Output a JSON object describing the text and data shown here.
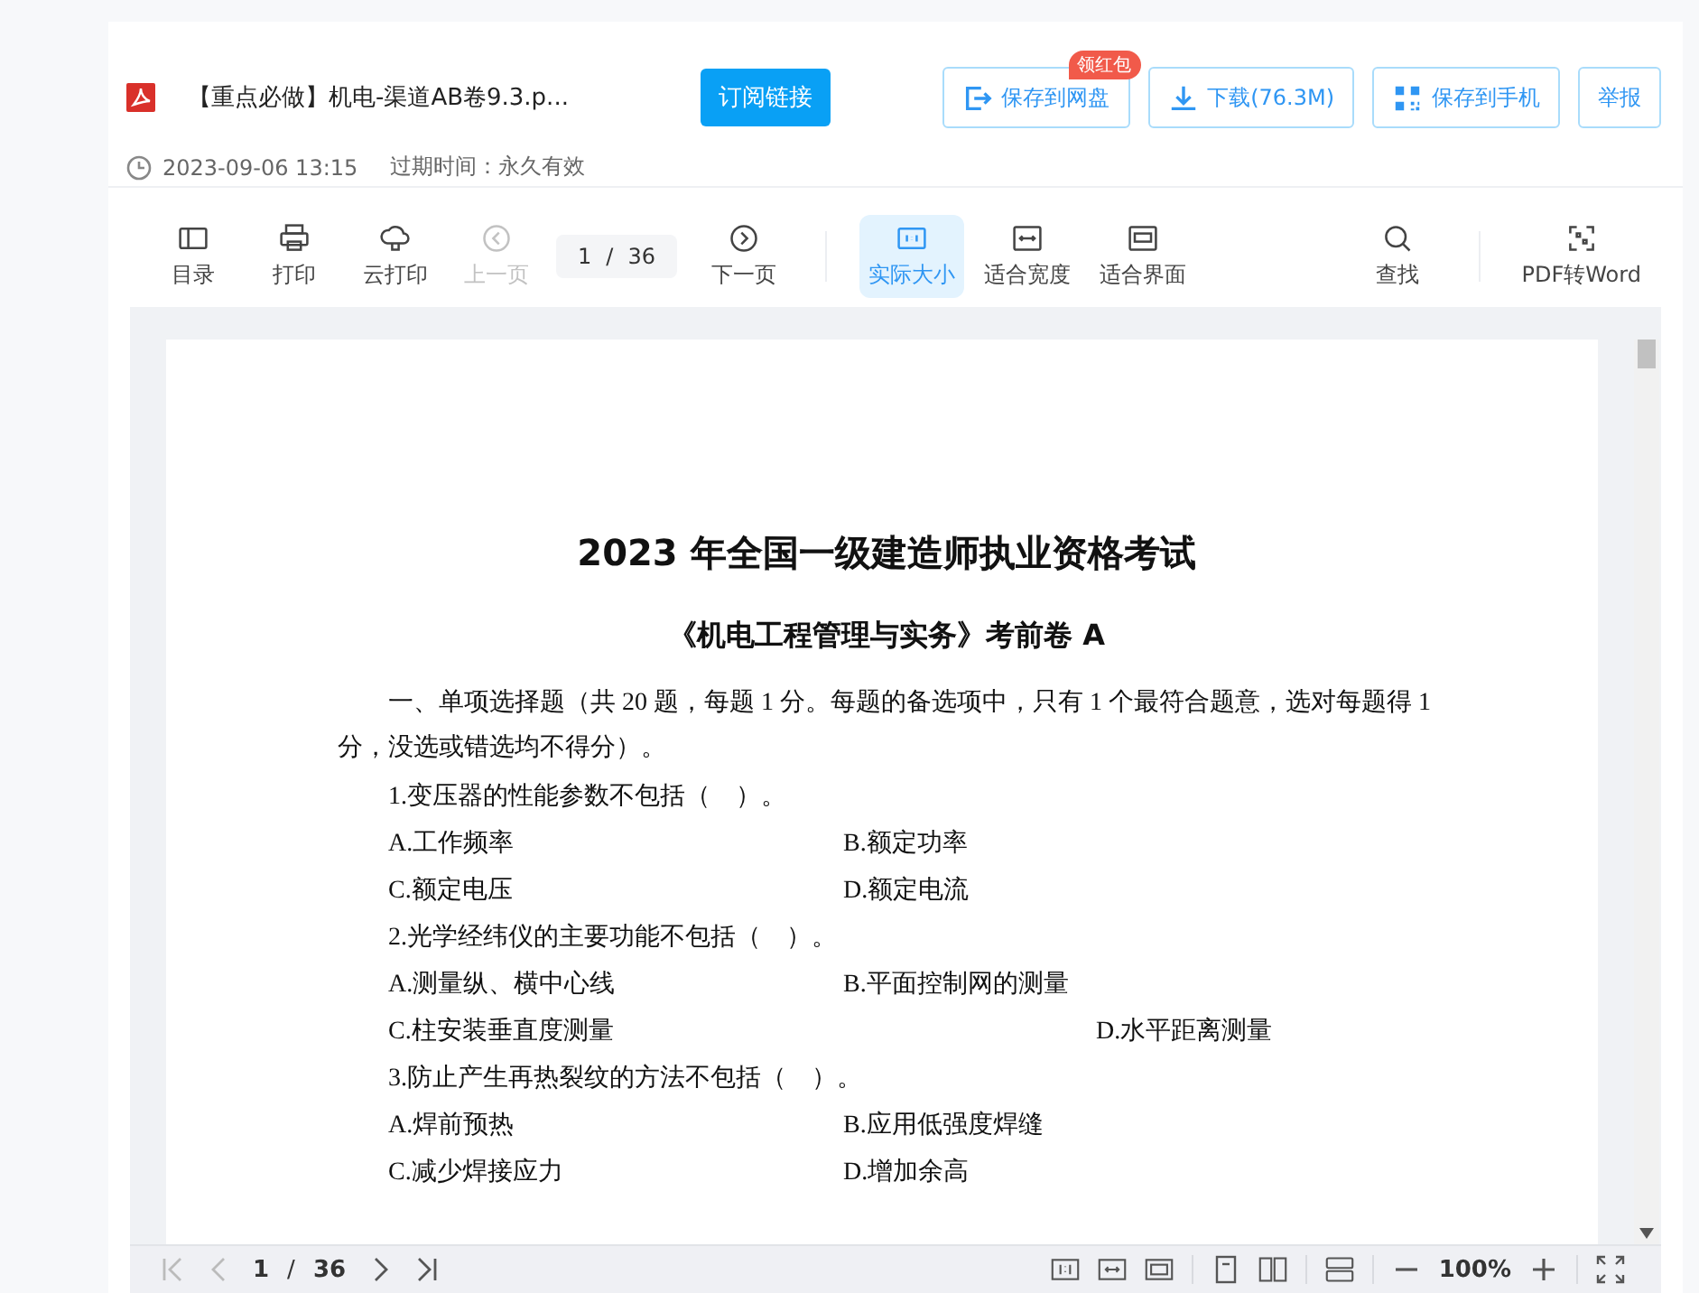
{
  "header": {
    "file_title": "【重点必做】机电-渠道AB卷9.3.p...",
    "subscribe_button": "订阅链接",
    "actions": [
      {
        "label": "保存到网盘",
        "badge": "领红包"
      },
      {
        "label": "下载(76.3M)"
      },
      {
        "label": "保存到手机"
      },
      {
        "label": "举报"
      }
    ],
    "date": "2023-09-06 13:15",
    "expiry": "过期时间：永久有效"
  },
  "toolbar": {
    "groups": [
      [
        {
          "kind": "tool",
          "label": "目录",
          "disabled": false,
          "selected": false
        },
        {
          "kind": "tool",
          "label": "打印",
          "disabled": false,
          "selected": false
        },
        {
          "kind": "tool",
          "label": "云打印",
          "disabled": false,
          "selected": false
        },
        {
          "kind": "tool",
          "label": "上一页",
          "disabled": true,
          "selected": false
        },
        {
          "kind": "pager",
          "page": "1",
          "separator": "/",
          "total": "36"
        },
        {
          "kind": "tool",
          "label": "下一页",
          "disabled": false,
          "selected": false
        }
      ],
      [
        {
          "kind": "tool",
          "label": "实际大小",
          "disabled": false,
          "selected": true
        },
        {
          "kind": "tool",
          "label": "适合宽度",
          "disabled": false,
          "selected": false
        },
        {
          "kind": "tool",
          "label": "适合界面",
          "disabled": false,
          "selected": false
        }
      ],
      [
        {
          "kind": "tool",
          "label": "查找",
          "disabled": false,
          "selected": false
        }
      ],
      [
        {
          "kind": "tool",
          "label": "PDF转Word",
          "disabled": false,
          "selected": false
        }
      ]
    ]
  },
  "document": [
    {
      "kind": "title",
      "text": "2023 年全国一级建造师执业资格考试"
    },
    {
      "kind": "subtitle",
      "text": "《机电工程管理与实务》考前卷 A"
    },
    {
      "kind": "section",
      "text": "一、单项选择题（共 20 题，每题 1 分。每题的备选项中，只有 1 个最符合题意，选对每题得 1 分，没选或错选均不得分）。"
    },
    {
      "kind": "question",
      "text": "1.变压器的性能参数不包括（　）。"
    },
    {
      "kind": "options",
      "options": [
        "A.工作频率",
        "B.额定功率"
      ]
    },
    {
      "kind": "options",
      "options": [
        "C.额定电压",
        "D.额定电流"
      ]
    },
    {
      "kind": "question",
      "text": "2.光学经纬仪的主要功能不包括（　）。"
    },
    {
      "kind": "options",
      "options": [
        "A.测量纵、横中心线",
        "B.平面控制网的测量"
      ]
    },
    {
      "kind": "options_wide",
      "options": [
        "C.柱安装垂直度测量",
        "D.水平距离测量"
      ]
    },
    {
      "kind": "question",
      "text": "3.防止产生再热裂纹的方法不包括（　）。"
    },
    {
      "kind": "options",
      "options": [
        "A.焊前预热",
        "B.应用低强度焊缝"
      ]
    },
    {
      "kind": "options",
      "options": [
        "C.减少焊接应力",
        "D.增加余高"
      ]
    }
  ],
  "bottom_bar": {
    "page": "1",
    "separator": "/",
    "total": "36",
    "zoom": "100%"
  }
}
